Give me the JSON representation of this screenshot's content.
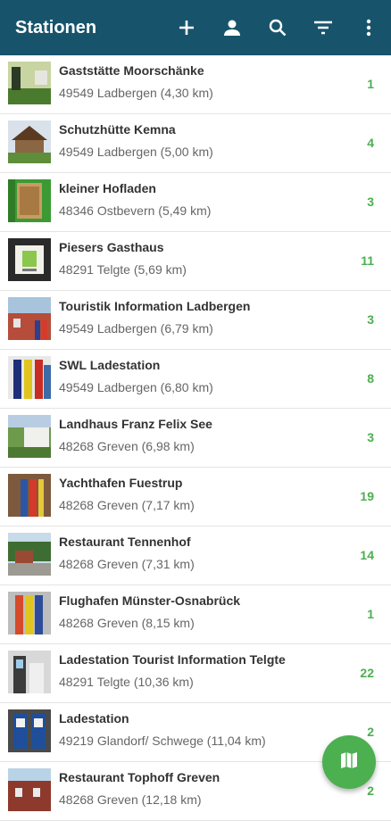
{
  "appbar": {
    "title": "Stationen",
    "actions": [
      "add-icon",
      "account-icon",
      "search-icon",
      "filter-icon",
      "more-vert-icon"
    ]
  },
  "stations": [
    {
      "name": "Gaststätte Moorschänke",
      "address": "49549 Ladbergen (4,30 km)",
      "count": "1"
    },
    {
      "name": "Schutzhütte Kemna",
      "address": "49549 Ladbergen (5,00 km)",
      "count": "4"
    },
    {
      "name": "kleiner Hofladen",
      "address": "48346 Ostbevern (5,49 km)",
      "count": "3"
    },
    {
      "name": "Piesers Gasthaus",
      "address": "48291 Telgte (5,69 km)",
      "count": "11"
    },
    {
      "name": "Touristik Information Ladbergen",
      "address": "49549 Ladbergen (6,79 km)",
      "count": "3"
    },
    {
      "name": "SWL Ladestation",
      "address": "49549 Ladbergen (6,80 km)",
      "count": "8"
    },
    {
      "name": "Landhaus Franz Felix See",
      "address": "48268 Greven (6,98 km)",
      "count": "3"
    },
    {
      "name": "Yachthafen Fuestrup",
      "address": "48268 Greven (7,17 km)",
      "count": "19"
    },
    {
      "name": "Restaurant Tennenhof",
      "address": "48268 Greven (7,31 km)",
      "count": "14"
    },
    {
      "name": "Flughafen Münster-Osnabrück",
      "address": "48268 Greven (8,15 km)",
      "count": "1"
    },
    {
      "name": "Ladestation Tourist Information Telgte",
      "address": "48291 Telgte (10,36 km)",
      "count": "22"
    },
    {
      "name": "Ladestation",
      "address": "49219 Glandorf/ Schwege (11,04 km)",
      "count": "2"
    },
    {
      "name": "Restaurant Tophoff Greven",
      "address": "48268 Greven (12,18 km)",
      "count": "2"
    }
  ],
  "fab": {
    "icon": "map-icon"
  },
  "colors": {
    "appbar": "#17546c",
    "accent": "#4caf50"
  }
}
